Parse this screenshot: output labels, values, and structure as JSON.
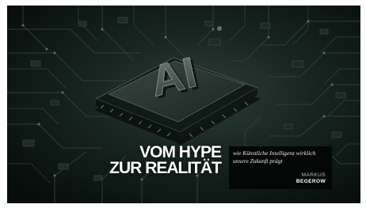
{
  "cover": {
    "chip_label": "AI",
    "headline": {
      "line1": "VOM HYPE",
      "line2": "ZUR REALITÄT"
    },
    "subtitle": "wie Künstliche Intelligenz wirklich unsere Zukunft prägt",
    "author": {
      "first": "MARKUS",
      "last": "BEGEROW"
    }
  },
  "colors": {
    "background": "#0c1614",
    "board": "#15231f",
    "chip_top": "#26332f",
    "text": "#ffffff",
    "subtitle_box": "#050707"
  }
}
